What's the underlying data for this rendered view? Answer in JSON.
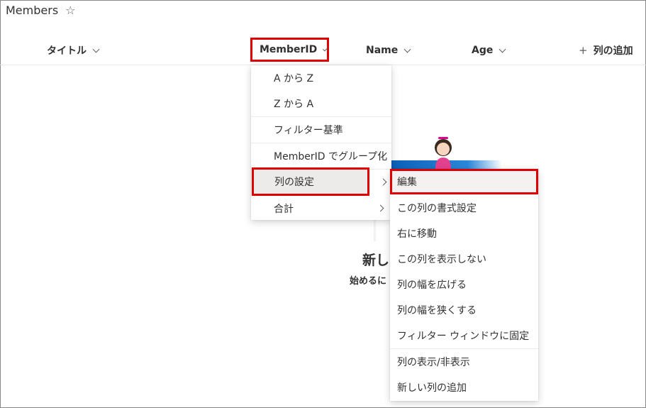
{
  "list": {
    "title": "Members"
  },
  "columns": {
    "title": "タイトル",
    "memberid": "MemberID",
    "name": "Name",
    "age": "Age",
    "add": "列の追加"
  },
  "empty_state": {
    "title": "新し",
    "subtitle": "始めるに"
  },
  "column_menu": {
    "items": [
      {
        "label": "A から Z"
      },
      {
        "label": "Z から A"
      },
      {
        "label": "フィルター基準"
      },
      {
        "label": "MemberID でグループ化"
      },
      {
        "label": "列の設定"
      },
      {
        "label": "合計"
      }
    ]
  },
  "column_settings_menu": {
    "items": [
      {
        "label": "編集"
      },
      {
        "label": "この列の書式設定"
      },
      {
        "label": "右に移動"
      },
      {
        "label": "この列を表示しない"
      },
      {
        "label": "列の幅を広げる"
      },
      {
        "label": "列の幅を狭くする"
      },
      {
        "label": "フィルター ウィンドウに固定"
      },
      {
        "label": "列の表示/非表示"
      },
      {
        "label": "新しい列の追加"
      }
    ]
  },
  "colors": {
    "highlight": "#e00000",
    "accent_blue": "#0078d4"
  }
}
